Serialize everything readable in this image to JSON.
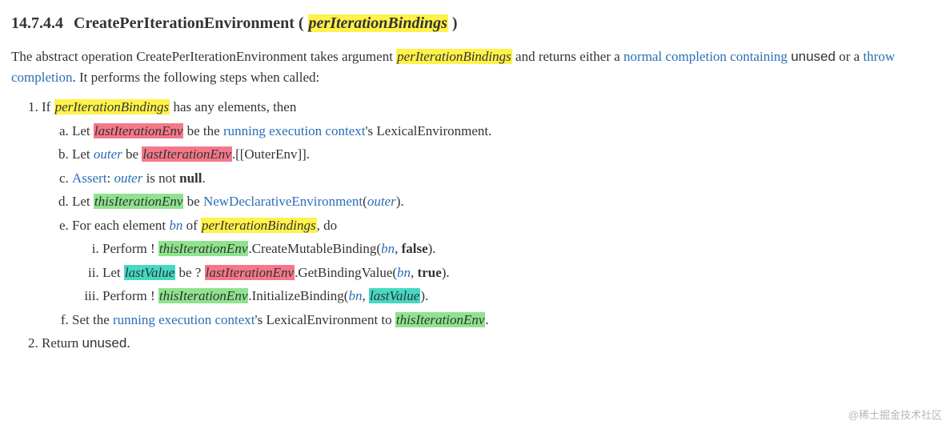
{
  "heading": {
    "secnum": "14.7.4.4",
    "name": "CreatePerIterationEnvironment",
    "param": "perIterationBindings"
  },
  "intro": {
    "t1": "The abstract operation CreatePerIterationEnvironment takes argument ",
    "param": "perIterationBindings",
    "t2": " and returns either a ",
    "link1": "normal completion containing",
    "unused": "unused",
    "t3": " or a ",
    "link2": "throw completion",
    "t4": ". It performs the following steps when called:"
  },
  "vars": {
    "perIterationBindings": "perIterationBindings",
    "lastIterationEnv": "lastIterationEnv",
    "outer": "outer",
    "thisIterationEnv": "thisIterationEnv",
    "bn": "bn",
    "lastValue": "lastValue"
  },
  "terms": {
    "running_execution_context": "running execution context",
    "Assert": "Assert",
    "NewDeclarativeEnvironment": "NewDeclarativeEnvironment"
  },
  "step1": {
    "pre": "If ",
    "post": " has any elements, then"
  },
  "step1a": {
    "pre": "Let ",
    "mid": " be the ",
    "post": "'s LexicalEnvironment."
  },
  "step1b": {
    "pre": "Let ",
    "mid": " be ",
    "post": ".[[OuterEnv]]."
  },
  "step1c": {
    "colon": ": ",
    "mid": " is not ",
    "null": "null",
    "dot": "."
  },
  "step1d": {
    "pre": "Let ",
    "mid": " be ",
    "open": "(",
    "close": ")."
  },
  "step1e": {
    "pre": "For each element ",
    "mid": " of ",
    "post": ", do"
  },
  "step1e_i": {
    "pre": "Perform ! ",
    "method": ".CreateMutableBinding(",
    "comma": ", ",
    "false": "false",
    "close": ")."
  },
  "step1e_ii": {
    "pre": "Let ",
    "mid": " be ? ",
    "method": ".GetBindingValue(",
    "comma": ", ",
    "true": "true",
    "close": ")."
  },
  "step1e_iii": {
    "pre": "Perform ! ",
    "method": ".InitializeBinding(",
    "comma": ", ",
    "close": ")."
  },
  "step1f": {
    "pre": "Set the ",
    "mid": "'s LexicalEnvironment to ",
    "dot": "."
  },
  "step2": {
    "pre": "Return ",
    "unused": "unused",
    "dot": "."
  },
  "watermark": "@稀土掘金技术社区"
}
